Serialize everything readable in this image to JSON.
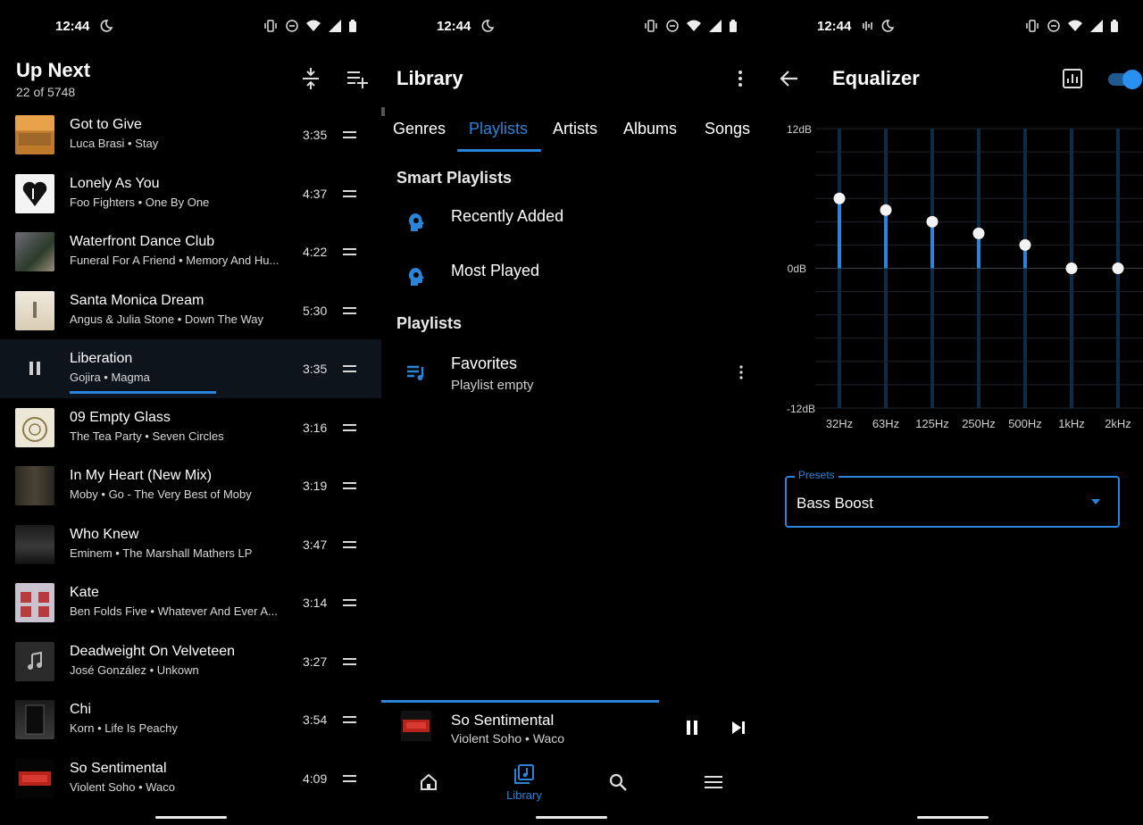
{
  "colors": {
    "accent": "#2a84d8",
    "background": "#000000",
    "active_row": "#0d141c"
  },
  "status_bar": {
    "time": "12:44"
  },
  "up_next": {
    "title": "Up Next",
    "subtitle": "22 of 5748",
    "tracks": [
      {
        "title": "Got to Give",
        "subtitle": "Luca Brasi • Stay",
        "duration": "3:35"
      },
      {
        "title": "Lonely As You",
        "subtitle": "Foo Fighters • One By One",
        "duration": "4:37"
      },
      {
        "title": "Waterfront Dance Club",
        "subtitle": "Funeral For A Friend • Memory And Hu...",
        "duration": "4:22"
      },
      {
        "title": "Santa Monica Dream",
        "subtitle": "Angus & Julia Stone • Down The Way",
        "duration": "5:30"
      },
      {
        "title": "Liberation",
        "subtitle": "Gojira • Magma",
        "duration": "3:35",
        "playing": true,
        "progress": 0.45
      },
      {
        "title": "09 Empty Glass",
        "subtitle": "The Tea Party • Seven Circles",
        "duration": "3:16"
      },
      {
        "title": "In My Heart (New Mix)",
        "subtitle": "Moby • Go - The Very Best of Moby",
        "duration": "3:19"
      },
      {
        "title": "Who Knew",
        "subtitle": "Eminem • The Marshall Mathers LP",
        "duration": "3:47"
      },
      {
        "title": "Kate",
        "subtitle": "Ben Folds Five • Whatever And Ever A...",
        "duration": "3:14"
      },
      {
        "title": "Deadweight On Velveteen",
        "subtitle": "José González • Unkown",
        "duration": "3:27"
      },
      {
        "title": "Chi",
        "subtitle": "Korn • Life Is Peachy",
        "duration": "3:54"
      },
      {
        "title": "So Sentimental",
        "subtitle": "Violent Soho • Waco",
        "duration": "4:09"
      }
    ]
  },
  "library": {
    "title": "Library",
    "tabs": [
      "Genres",
      "Playlists",
      "Artists",
      "Albums",
      "Songs"
    ],
    "selected_tab": "Playlists",
    "smart_playlists_heading": "Smart Playlists",
    "smart_playlists": [
      "Recently Added",
      "Most Played"
    ],
    "playlists_heading": "Playlists",
    "playlists": [
      {
        "name": "Favorites",
        "subtitle": "Playlist empty"
      }
    ],
    "now_playing": {
      "title": "So Sentimental",
      "subtitle": "Violent Soho • Waco",
      "progress": 0.73
    },
    "bottom_nav": {
      "active": "Library",
      "active_label": "Library",
      "items": [
        "home-icon",
        "library-icon",
        "search-icon",
        "menu-icon"
      ]
    }
  },
  "equalizer": {
    "title": "Equalizer",
    "enabled": true,
    "y_max_label": "12dB",
    "y_mid_label": "0dB",
    "y_min_label": "-12dB",
    "ylim": [
      -12,
      12
    ],
    "bands": [
      {
        "label": "32Hz",
        "gain": 6
      },
      {
        "label": "63Hz",
        "gain": 5
      },
      {
        "label": "125Hz",
        "gain": 4
      },
      {
        "label": "250Hz",
        "gain": 3
      },
      {
        "label": "500Hz",
        "gain": 2
      },
      {
        "label": "1kHz",
        "gain": 0
      },
      {
        "label": "2kHz",
        "gain": 0
      }
    ],
    "presets_label": "Presets",
    "preset_value": "Bass Boost"
  }
}
